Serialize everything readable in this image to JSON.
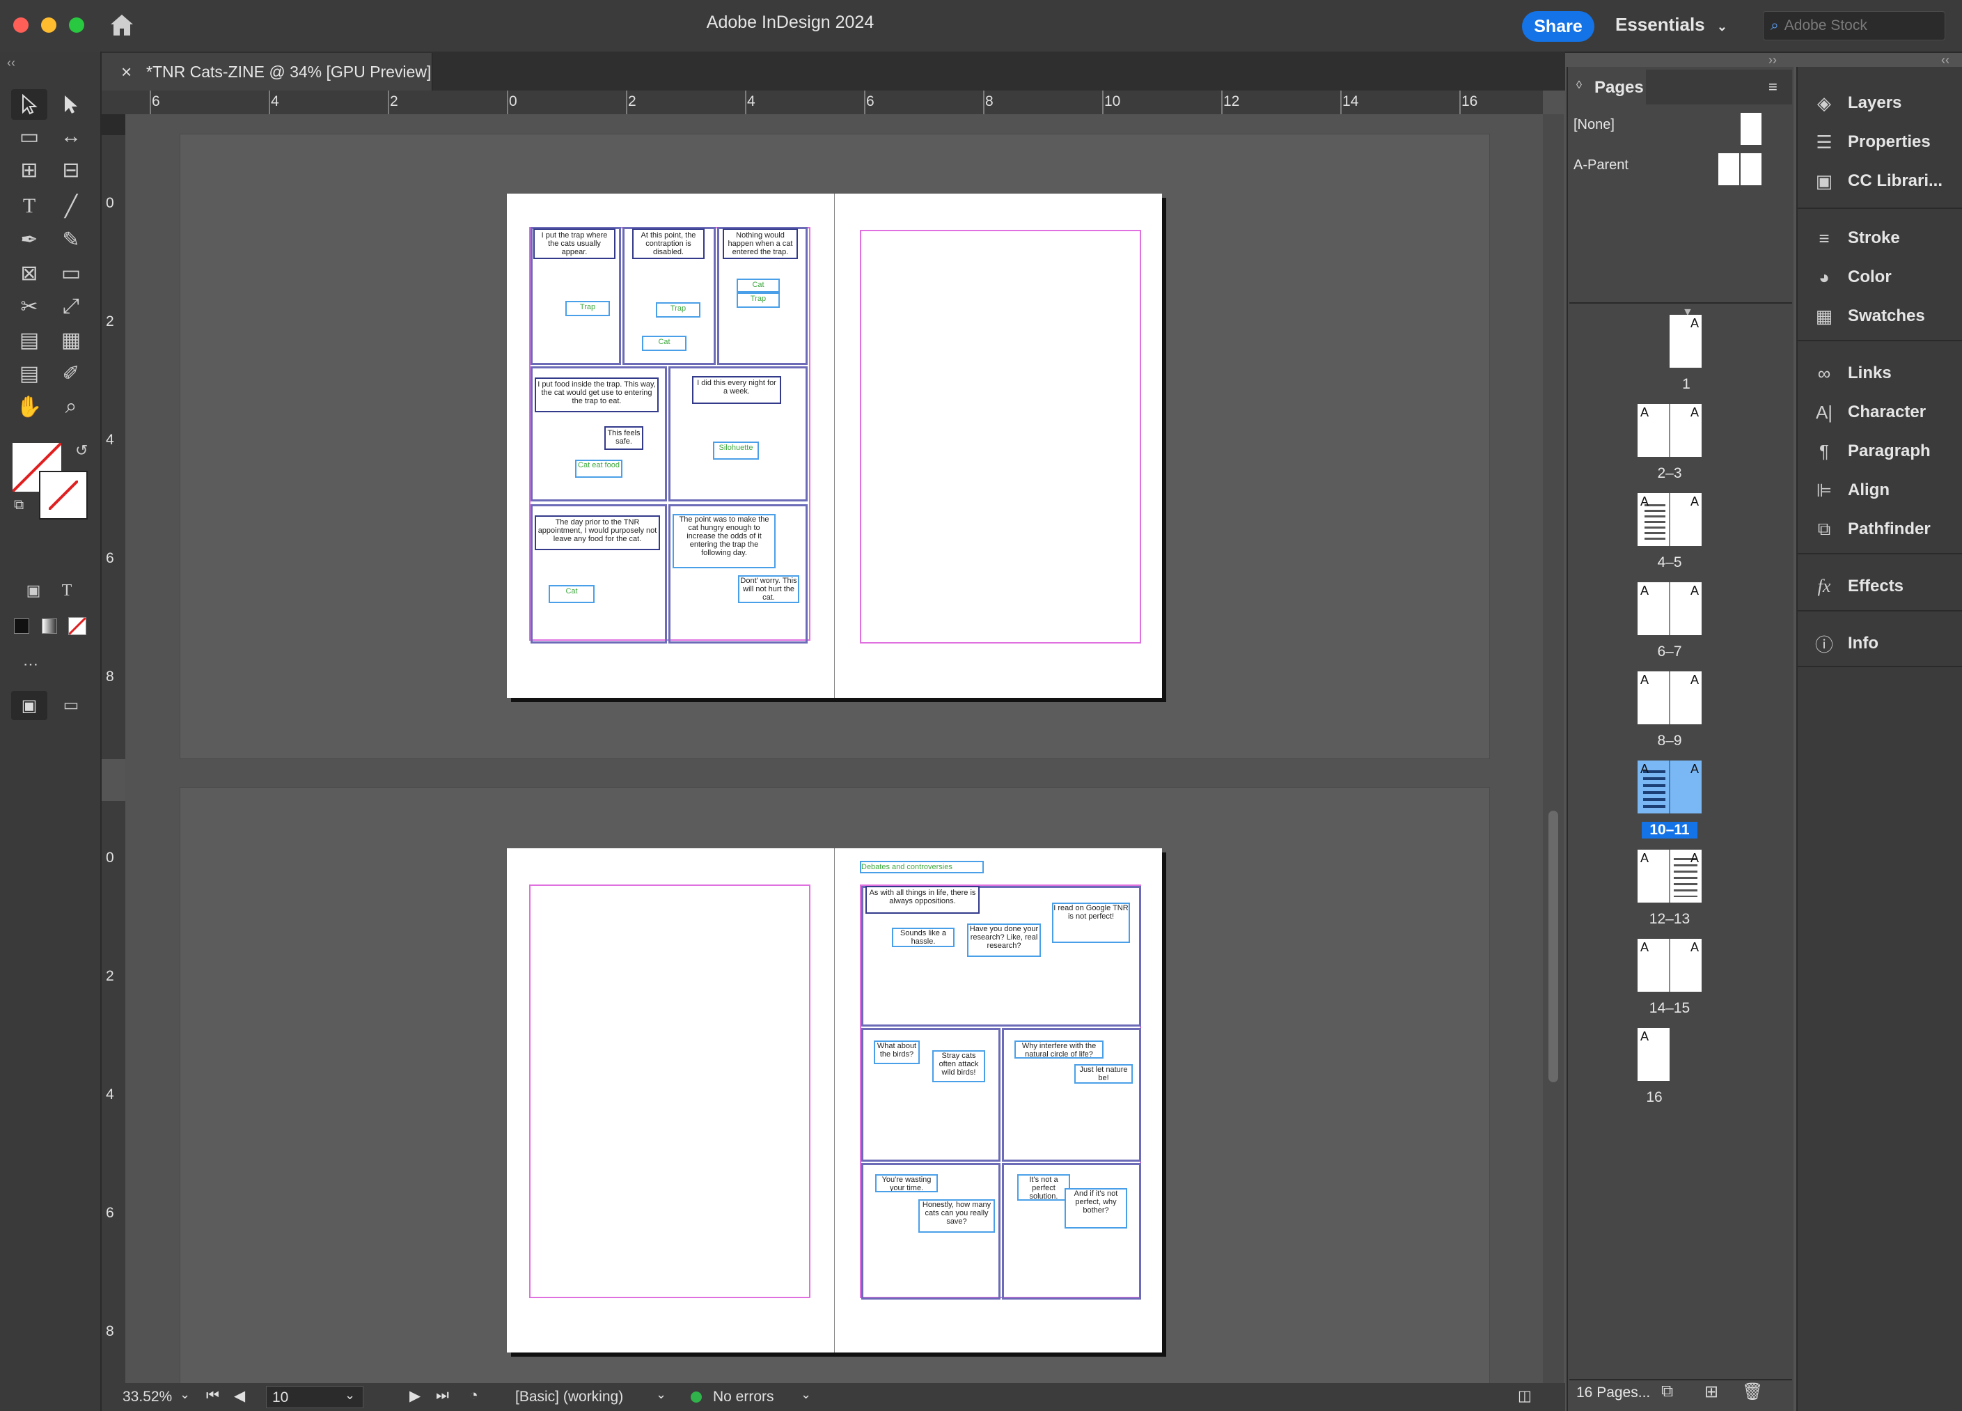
{
  "app": {
    "title": "Adobe InDesign 2024",
    "share_label": "Share",
    "workspace_label": "Essentials",
    "stock_placeholder": "Adobe Stock"
  },
  "document": {
    "tab_title": "*TNR Cats-ZINE @ 34% [GPU Preview]",
    "close_glyph": "×"
  },
  "rulers": {
    "horizontal": [
      "6",
      "4",
      "2",
      "0",
      "2",
      "4",
      "6",
      "8",
      "10",
      "12",
      "14",
      "16"
    ],
    "vertical_top": [
      "0",
      "2",
      "4",
      "6",
      "8"
    ],
    "vertical_bottom": [
      "0",
      "2",
      "4",
      "6",
      "8"
    ]
  },
  "spread_10_11": {
    "panels": {
      "p1_caption": "I put the trap where the cats usually appear.",
      "p1_label": "Trap",
      "p2_caption": "At this point, the contraption is disabled.",
      "p2_label_trap": "Trap",
      "p2_label_cat": "Cat",
      "p3_caption": "Nothing would happen when a cat entered the trap.",
      "p3_label_cat": "Cat",
      "p3_label_trap": "Trap",
      "p4_caption": "I put food inside the trap. This way, the cat would get use to entering the trap to eat.",
      "p4_bubble": "This feels safe.",
      "p4_label": "Cat eat food",
      "p5_caption": "I did this every night for a week.",
      "p5_label": "Silohuette",
      "p6_caption": "The day prior to the TNR appointment, I would purposely not leave any food for the cat.",
      "p6_label": "Cat",
      "p7_caption": "The point was to make the cat hungry enough to increase the odds of it entering the trap the following day.",
      "p7_bubble": "Dont' worry. This will not hurt the cat."
    }
  },
  "spread_12_13": {
    "header_label": "Debates and controversies",
    "caption": "As with all things in life, there is always oppositions.",
    "bubbles": {
      "hassle": "Sounds like a hassle.",
      "research": "Have you done your research? Like, real research?",
      "google": "I read on Google TNR is not perfect!",
      "birds": "What about the birds?",
      "stray": "Stray cats often attack wild birds!",
      "interfere": "Why interfere with the natural circle of life?",
      "nature": "Just let nature be!",
      "wasting": "You're wasting your time.",
      "honestly": "Honestly, how many cats can you really save?",
      "not_perfect": "It's not a perfect solution.",
      "why_bother": "And if it's not perfect, why bother?"
    }
  },
  "status": {
    "zoom": "33.52%",
    "page_field": "10",
    "preflight_profile": "[Basic] (working)",
    "errors": "No errors"
  },
  "pages_panel": {
    "title": "Pages",
    "parents": [
      {
        "label": "[None]"
      },
      {
        "label": "A-Parent"
      }
    ],
    "spreads": [
      "1",
      "2–3",
      "4–5",
      "6–7",
      "8–9",
      "10–11",
      "12–13",
      "14–15",
      "16"
    ],
    "selected": "10–11",
    "footer": "16 Pages...",
    "thumb_letter": "A"
  },
  "dock": {
    "items": [
      {
        "label": "Layers",
        "icon": "layers-icon"
      },
      {
        "label": "Properties",
        "icon": "properties-icon"
      },
      {
        "label": "CC Librari...",
        "icon": "cc-libraries-icon"
      },
      {
        "label": "Stroke",
        "icon": "stroke-icon"
      },
      {
        "label": "Color",
        "icon": "color-icon"
      },
      {
        "label": "Swatches",
        "icon": "swatches-icon"
      },
      {
        "label": "Links",
        "icon": "links-icon"
      },
      {
        "label": "Character",
        "icon": "character-icon"
      },
      {
        "label": "Paragraph",
        "icon": "paragraph-icon"
      },
      {
        "label": "Align",
        "icon": "align-icon"
      },
      {
        "label": "Pathfinder",
        "icon": "pathfinder-icon"
      },
      {
        "label": "Effects",
        "icon": "effects-icon"
      },
      {
        "label": "Info",
        "icon": "info-icon"
      }
    ]
  },
  "colors": {
    "accent": "#1473e6",
    "selection": "#7ab8f5",
    "margin_guide": "#e070e0",
    "frame_guide": "#4aa0e8",
    "no_errors": "#2fb34a"
  }
}
